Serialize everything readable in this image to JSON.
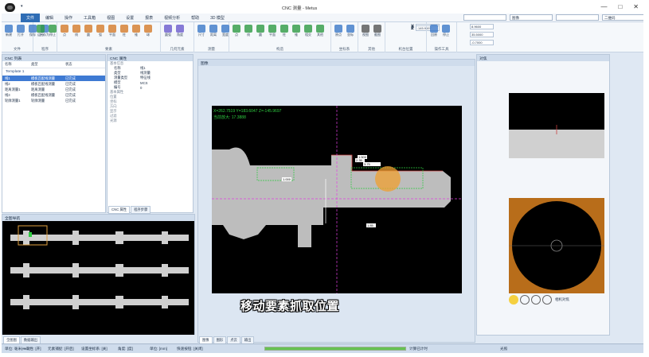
{
  "window": {
    "title": "CNC 测量 - Metus",
    "minimize": "—",
    "maximize": "□",
    "close": "✕"
  },
  "menu": {
    "items": [
      "文件",
      "编辑",
      "操作",
      "工具箱",
      "视图",
      "设置",
      "报表",
      "视频分析",
      "帮助",
      "3D 模型"
    ],
    "active_index": 0
  },
  "menu_combos": [
    "",
    "图像",
    "",
    "二维码"
  ],
  "ribbon": {
    "groups": [
      {
        "label": "文件",
        "buttons": [
          "新建",
          "打开",
          "保存",
          "另存为"
        ]
      },
      {
        "label": "程序",
        "buttons": [
          "运行",
          "停止"
        ]
      },
      {
        "label": "要素",
        "buttons": [
          "点",
          "线",
          "圆",
          "弧",
          "平面",
          "柱",
          "锥",
          "球"
        ]
      },
      {
        "label": "几何元素",
        "buttons": [
          "圆弧",
          "角度"
        ]
      },
      {
        "label": "测量",
        "buttons": [
          "尺寸",
          "距离",
          "宽度"
        ]
      },
      {
        "label": "构造",
        "buttons": [
          "点",
          "线",
          "圆",
          "平面",
          "柱",
          "锥",
          "相交",
          "其他"
        ]
      },
      {
        "label": "坐标系",
        "buttons": [
          "原点",
          "坐标"
        ]
      },
      {
        "label": "其他",
        "buttons": [
          "视图",
          "截图"
        ]
      },
      {
        "label": "机台位置",
        "buttons": []
      },
      {
        "label": "操作工具",
        "buttons": [
          "回原",
          "停止"
        ]
      }
    ],
    "coords": {
      "x": "262.7519",
      "y": "183.6047",
      "z": "-145.9697",
      "x2": "8.9600",
      "y2": "35.5000",
      "z2": "-0.7000"
    }
  },
  "cnc_panel": {
    "title": "CNC 列表",
    "headers": [
      "名称",
      "类型",
      "状态"
    ],
    "group_label": "Template 1",
    "rows": [
      {
        "name": "线1",
        "type": "模板匹配线测量",
        "status": "已完成",
        "selected": true
      },
      {
        "name": "线2",
        "type": "模板匹配线测量",
        "status": "已完成",
        "selected": false
      },
      {
        "name": "距离测量1",
        "type": "距离测量",
        "status": "已完成",
        "selected": false
      },
      {
        "name": "线3",
        "type": "模板匹配线测量",
        "status": "已完成",
        "selected": false
      },
      {
        "name": "轮廓测量1",
        "type": "轮廓测量",
        "status": "已完成",
        "selected": false
      }
    ]
  },
  "props_panel": {
    "title": "CNC 属性",
    "groups": [
      "基本信息",
      "测量结果",
      "公差",
      "其他"
    ],
    "rows": [
      [
        "名称",
        "线1"
      ],
      [
        "类型",
        "线测量"
      ],
      [
        "测量类型",
        "特征线"
      ],
      [
        "模型",
        "MCS"
      ],
      [
        "编号",
        "0"
      ]
    ],
    "collapsed": [
      "基本属性",
      "位置",
      "坐标",
      "方向",
      "显示",
      "过滤",
      "光源"
    ],
    "tabs": [
      "CNC 属性",
      "程序步骤"
    ]
  },
  "nav_panel": {
    "title": "全图导航"
  },
  "main": {
    "title": "图像",
    "readout": "X=262.7519 Y=183.6047 Z=-145.9697",
    "readout2": "当前放大: 17.3888",
    "labels": {
      "l1": "1.000",
      "l2": "3.75",
      "l3": "1.500",
      "l4": "2.35",
      "l5": "1.85",
      "l6": "3.00"
    }
  },
  "right_panel": {
    "title": "对焦",
    "legend": "相机对焦"
  },
  "bottom_tabs_left": [
    "全图图",
    "数据输出"
  ],
  "bottom_tabs_main": [
    "图像",
    "图形",
    "点云",
    "输出"
  ],
  "status": {
    "items": [
      "单位: 毫米(mm)",
      "一次性: [开]",
      "元素捕捉: [开启]",
      "设置坐标系: [关]",
      "角度: [度]",
      "单位: [mm]",
      "快速按钮: [关闭]"
    ],
    "progress_pct": 1.0,
    "progress_label": "计算已计时",
    "right": "光照"
  },
  "caption": "移动要素抓取位置"
}
